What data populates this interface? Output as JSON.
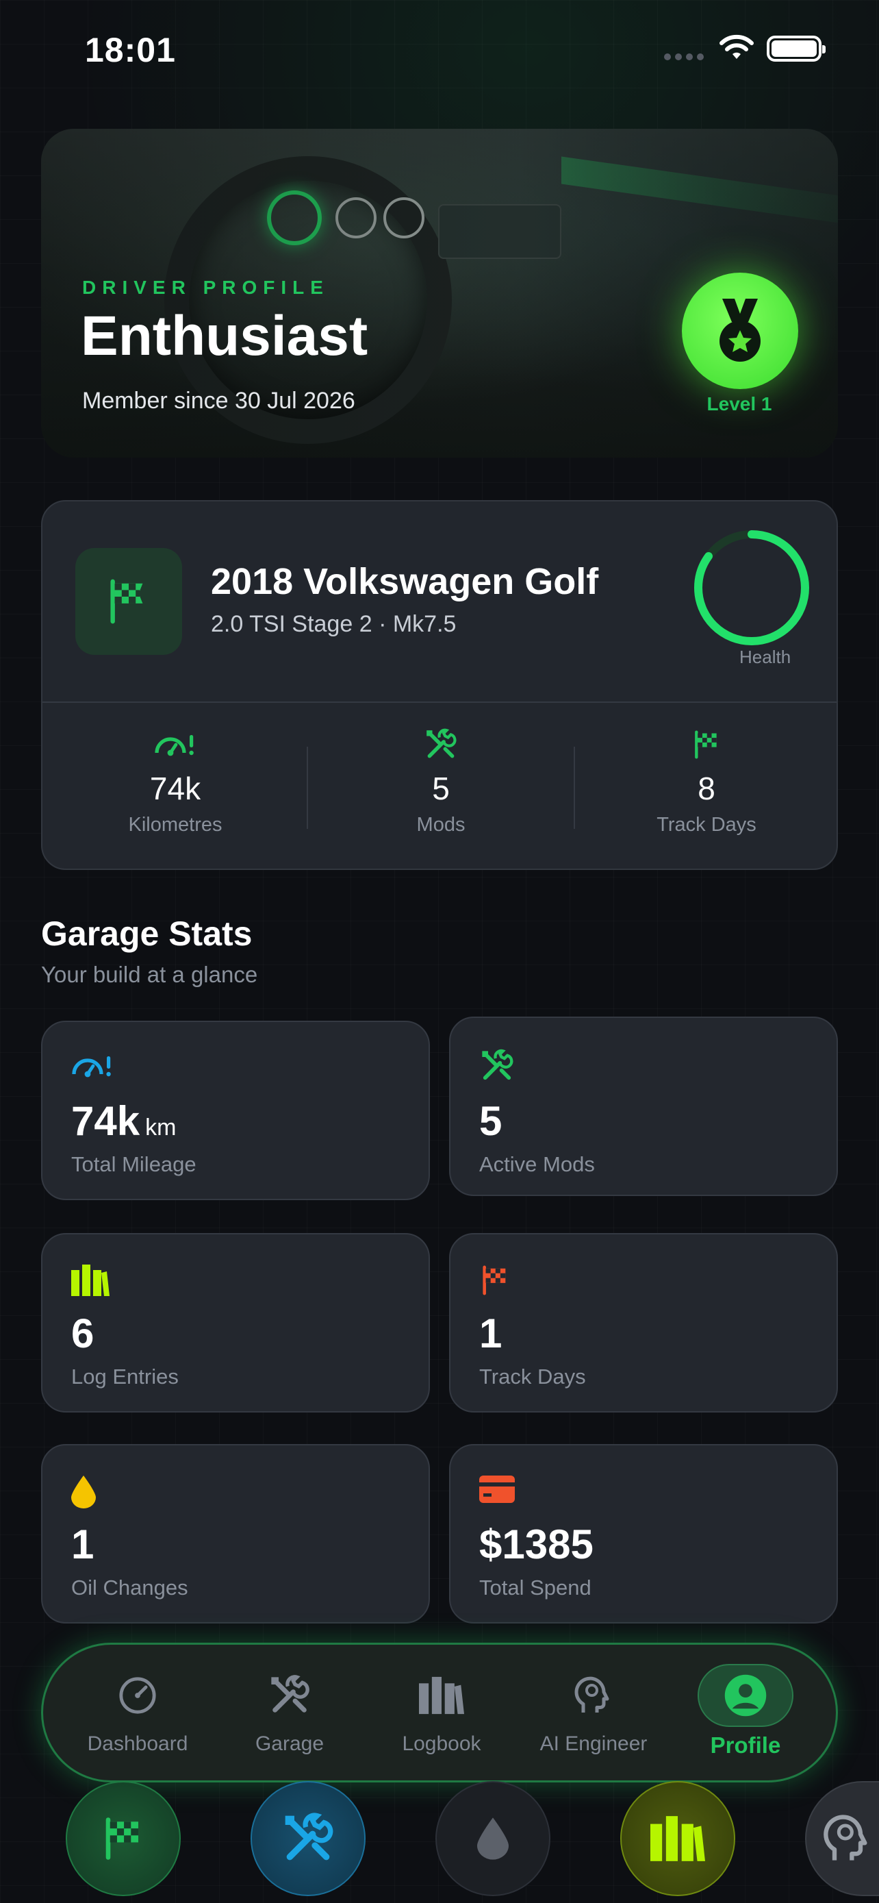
{
  "status_bar": {
    "time": "18:01"
  },
  "hero": {
    "eyebrow": "DRIVER PROFILE",
    "title": "Enthusiast",
    "member_since": "Member since 30 Jul 2026",
    "level": "Level 1",
    "badge_icon": "medal-icon"
  },
  "vehicle": {
    "name": "2018 Volkswagen Golf",
    "subtitle": "2.0 TSI Stage 2  ·  Mk7.5",
    "icon": "checkered-flag-icon",
    "health_label": "Health",
    "health_fraction": 0.85,
    "stats": [
      {
        "icon": "speedometer-icon",
        "value": "74k",
        "label": "Kilometres"
      },
      {
        "icon": "tools-icon",
        "value": "5",
        "label": "Mods"
      },
      {
        "icon": "checkered-flag-icon",
        "value": "8",
        "label": "Track Days"
      }
    ]
  },
  "garage_stats": {
    "title": "Garage Stats",
    "subtitle": "Your build at a glance",
    "tiles": [
      {
        "icon": "speedometer-icon",
        "color": "#1aa6e6",
        "value": "74k",
        "unit": "km",
        "label": "Total Mileage"
      },
      {
        "icon": "tools-icon",
        "color": "#22c55e",
        "value": "5",
        "unit": "",
        "label": "Active Mods"
      },
      {
        "icon": "books-icon",
        "color": "#b6f500",
        "value": "6",
        "unit": "",
        "label": "Log Entries"
      },
      {
        "icon": "checkered-flag-icon",
        "color": "#f0522c",
        "value": "1",
        "unit": "",
        "label": "Track Days"
      },
      {
        "icon": "oil-drop-icon",
        "color": "#f5c400",
        "value": "1",
        "unit": "",
        "label": "Oil Changes"
      },
      {
        "icon": "credit-card-icon",
        "color": "#f0522c",
        "value": "$1385",
        "unit": "",
        "label": "Total Spend"
      }
    ]
  },
  "nav": {
    "items": [
      {
        "label": "Dashboard",
        "icon": "gauge-icon",
        "active": false
      },
      {
        "label": "Garage",
        "icon": "tools-icon",
        "active": false
      },
      {
        "label": "Logbook",
        "icon": "books-icon",
        "active": false
      },
      {
        "label": "AI Engineer",
        "icon": "brain-head-icon",
        "active": false
      },
      {
        "label": "Profile",
        "icon": "profile-icon",
        "active": true
      }
    ]
  },
  "quick_actions": [
    {
      "icon": "checkered-flag-icon",
      "color": "#22c55e"
    },
    {
      "icon": "tools-icon",
      "color": "#1aa6e6"
    },
    {
      "icon": "oil-drop-icon",
      "color": "#6b7078"
    },
    {
      "icon": "books-icon",
      "color": "#b6f500"
    },
    {
      "icon": "brain-head-icon",
      "color": "#9aa0a8"
    }
  ],
  "colors": {
    "accent": "#22c55e",
    "background": "#0d0f13",
    "card": "#23272e"
  }
}
